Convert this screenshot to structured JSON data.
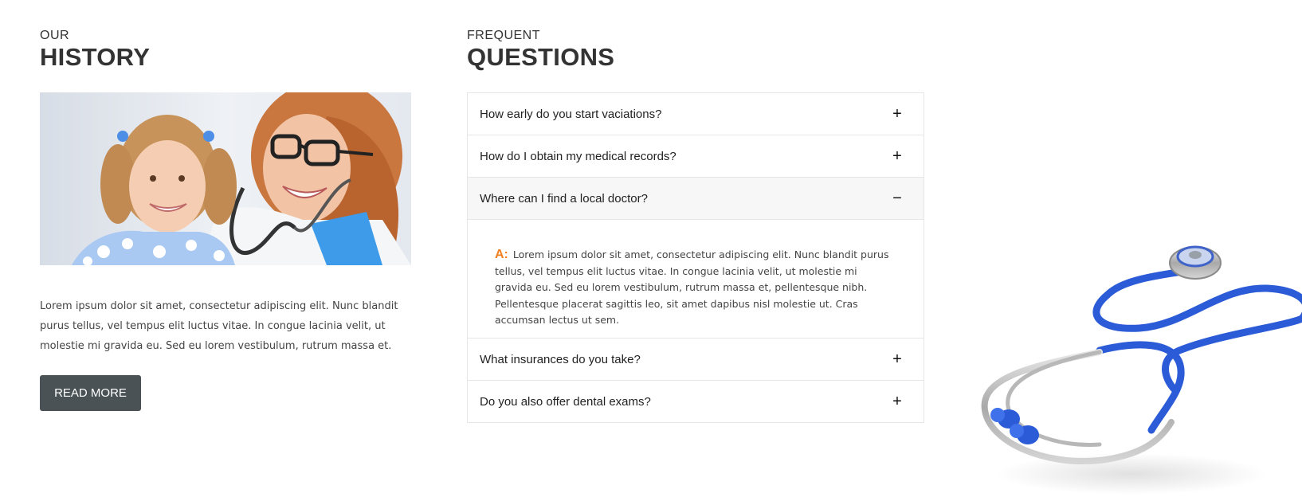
{
  "history": {
    "kicker": "OUR",
    "title": "HISTORY",
    "text": "Lorem ipsum dolor sit amet, consectetur adipiscing elit. Nunc blandit purus tellus, vel tempus elit luctus vitae. In congue lacinia velit, ut molestie mi gravida eu. Sed eu lorem vestibulum, rutrum massa et.",
    "button_label": "READ MORE"
  },
  "faq": {
    "kicker": "FREQUENT",
    "title": "QUESTIONS",
    "items": [
      {
        "question": "How early do you start vaciations?",
        "toggle": "+"
      },
      {
        "question": "How do I obtain my medical records?",
        "toggle": "+"
      },
      {
        "question": "Where can I find a local doctor?",
        "toggle": "−",
        "answer_prefix": "A:",
        "answer": "Lorem ipsum dolor sit amet, consectetur adipiscing elit. Nunc blandit purus tellus, vel tempus elit luctus vitae. In congue lacinia velit, ut molestie mi gravida eu. Sed eu lorem vestibulum, rutrum massa et, pellentesque nibh. Pellentesque placerat sagittis leo, sit amet dapibus nisl molestie ut. Cras accumsan lectus ut sem."
      },
      {
        "question": "What insurances do you take?",
        "toggle": "+"
      },
      {
        "question": "Do you also offer dental exams?",
        "toggle": "+"
      }
    ]
  },
  "colors": {
    "accent": "#f07f1f",
    "button": "#4a5256",
    "stethoscope_tube": "#2b5bd7"
  },
  "icons": {
    "expand": "plus-icon",
    "collapse": "minus-icon"
  }
}
